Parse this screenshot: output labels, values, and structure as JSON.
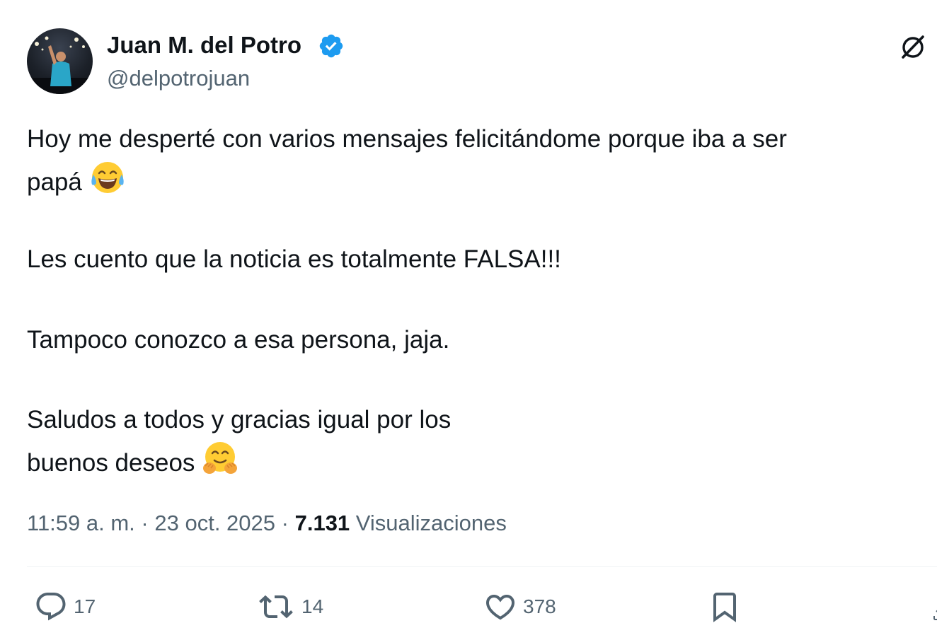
{
  "author": {
    "display_name": "Juan M. del Potro",
    "handle": "@delpotrojuan",
    "verified": true
  },
  "tweet": {
    "lines": [
      "Hoy me desperté con varios mensajes felicitándome porque iba a ser",
      "papá",
      "Les cuento que la noticia es totalmente FALSA!!!",
      "Tampoco conozco a esa persona, jaja.",
      "Saludos a todos y gracias igual por los",
      "buenos deseos"
    ],
    "emojis": {
      "line2": "face-with-tears-of-joy",
      "line6": "hugging-face"
    }
  },
  "meta": {
    "time": "11:59 a. m.",
    "separator": "·",
    "date": "23 oct. 2025",
    "views_count": "7.131",
    "views_label": "Visualizaciones"
  },
  "actions": {
    "reply_count": "17",
    "retweet_count": "14",
    "like_count": "378"
  },
  "icons": {
    "verified": "verified-badge-icon",
    "grok": "grok-icon",
    "reply": "reply-icon",
    "retweet": "retweet-icon",
    "like": "heart-icon",
    "bookmark": "bookmark-icon",
    "share": "share-icon"
  },
  "colors": {
    "verified_blue": "#1d9bf0",
    "text_primary": "#0f1419",
    "text_secondary": "#536471",
    "divider": "#eff3f4"
  }
}
